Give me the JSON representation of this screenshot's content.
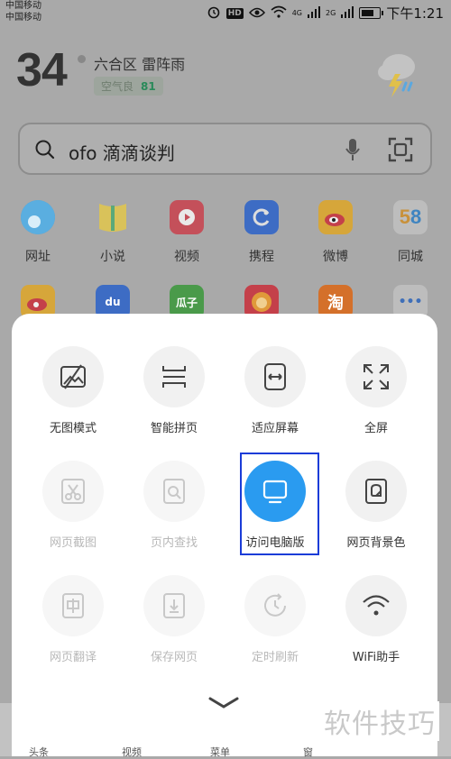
{
  "status": {
    "carrier1": "中国移动",
    "carrier2": "中国移动",
    "net_label": "4G",
    "net_label2": "2G",
    "time": "下午1:21"
  },
  "weather": {
    "temperature": "34",
    "location": "六合区  雷阵雨",
    "air_quality_label": "空气良",
    "air_quality_value": "81"
  },
  "search": {
    "query": "ofo 滴滴谈判"
  },
  "apps_row1": [
    {
      "label": "网址",
      "icon": "globe-icon"
    },
    {
      "label": "小说",
      "icon": "book-icon"
    },
    {
      "label": "视频",
      "icon": "video-icon"
    },
    {
      "label": "携程",
      "icon": "ctrip-icon"
    },
    {
      "label": "微博",
      "icon": "weibo-icon"
    },
    {
      "label": "同城",
      "icon": "58-icon"
    }
  ],
  "apps_row2_text": {
    "a": "du",
    "b": "瓜子",
    "c": "淘",
    "d": "•••"
  },
  "tools": [
    {
      "label": "无图模式",
      "icon": "no-image-icon",
      "disabled": false
    },
    {
      "label": "智能拼页",
      "icon": "smart-page-icon",
      "disabled": false
    },
    {
      "label": "适应屏幕",
      "icon": "fit-screen-icon",
      "disabled": false
    },
    {
      "label": "全屏",
      "icon": "fullscreen-icon",
      "disabled": false
    },
    {
      "label": "网页截图",
      "icon": "screenshot-icon",
      "disabled": true
    },
    {
      "label": "页内查找",
      "icon": "find-in-page-icon",
      "disabled": true
    },
    {
      "label": "访问电脑版",
      "icon": "desktop-icon",
      "disabled": false
    },
    {
      "label": "网页背景色",
      "icon": "background-color-icon",
      "disabled": false
    },
    {
      "label": "网页翻译",
      "icon": "translate-icon",
      "disabled": true
    },
    {
      "label": "保存网页",
      "icon": "save-page-icon",
      "disabled": true
    },
    {
      "label": "定时刷新",
      "icon": "timed-refresh-icon",
      "disabled": true
    },
    {
      "label": "WiFi助手",
      "icon": "wifi-icon",
      "disabled": false
    }
  ],
  "watermark": "软件技巧",
  "bottom_nav": [
    "头条",
    "视频",
    "菜单",
    "窗"
  ],
  "colors": {
    "accent": "#2a9bf0",
    "highlight_border": "#1a3cd8",
    "overlay": "#a9a9a9",
    "panel": "#ffffff"
  }
}
